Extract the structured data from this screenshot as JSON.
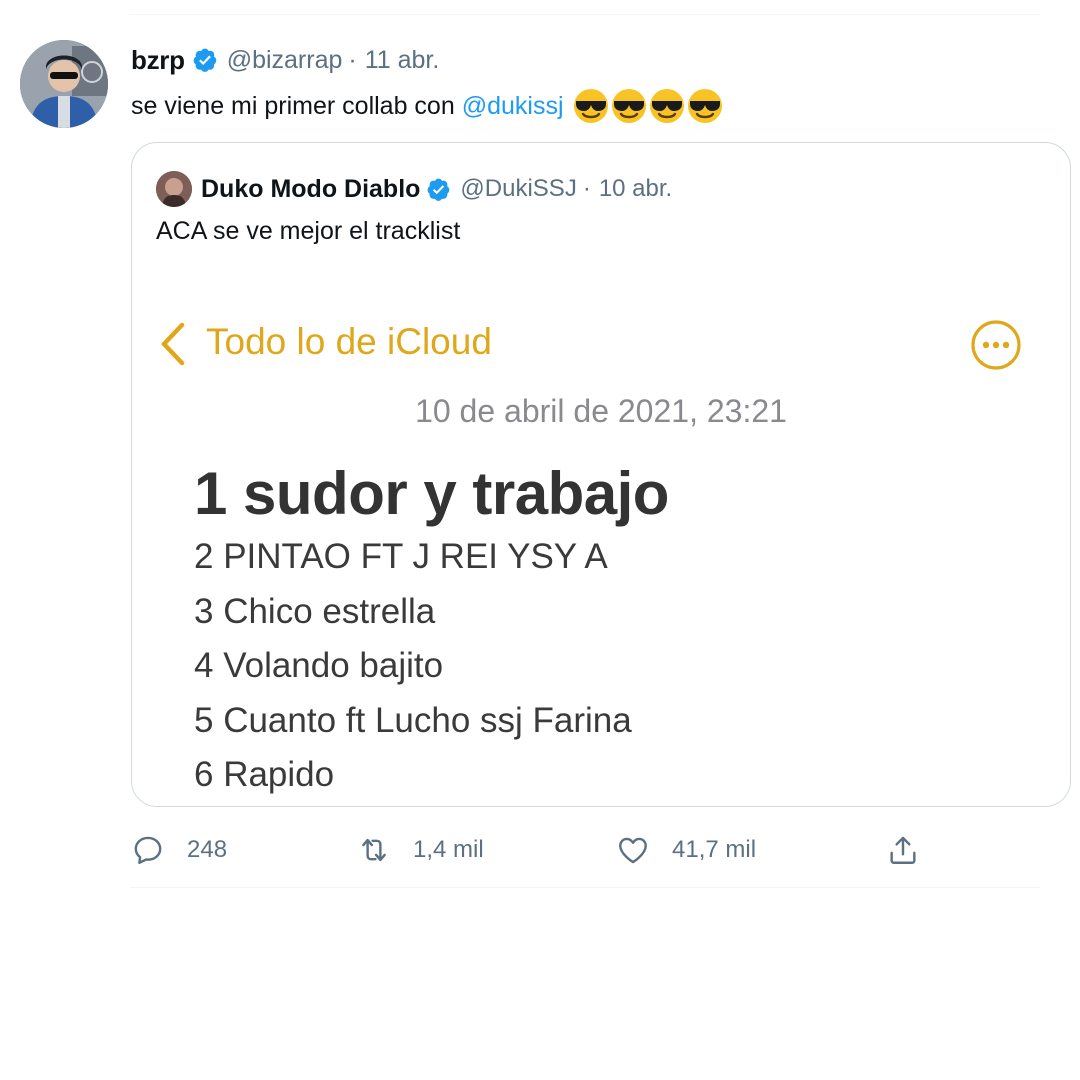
{
  "tweet": {
    "author": {
      "name": "bzrp",
      "handle": "@bizarrap",
      "separator": "·",
      "date": "11 abr.",
      "avatar_icon": "user-avatar"
    },
    "text": {
      "prefix": "se viene mi primer collab con",
      "mention": "@dukissj",
      "emojis": [
        "😎",
        "😎",
        "😎",
        "😎"
      ]
    },
    "colors": {
      "link": "#1d9bf0",
      "secondary": "#5b7083",
      "verified": "#1d9bf0",
      "notes_accent": "#dfa719"
    },
    "quoted": {
      "author": {
        "name": "Duko Modo Diablo",
        "handle": "@DukiSSJ",
        "separator": "·",
        "date": "10 abr."
      },
      "text": "ACA se ve mejor el tracklist",
      "note": {
        "back_label": "Todo lo de iCloud",
        "back_icon": "chevron-left-icon",
        "more_icon": "ellipsis-circle-icon",
        "date": "10 de abril de 2021, 23:21",
        "title": "1 sudor y trabajo",
        "lines": [
          "2 PINTAO FT J REI YSY A",
          "3 Chico estrella",
          "4 Volando bajito",
          "5 Cuanto ft Lucho ssj Farina",
          "6 Rapido"
        ]
      }
    },
    "actions": {
      "reply": {
        "icon": "reply-icon",
        "count": "248"
      },
      "retweet": {
        "icon": "retweet-icon",
        "count": "1,4 mil"
      },
      "like": {
        "icon": "heart-icon",
        "count": "41,7 mil"
      },
      "share": {
        "icon": "share-icon"
      }
    }
  }
}
